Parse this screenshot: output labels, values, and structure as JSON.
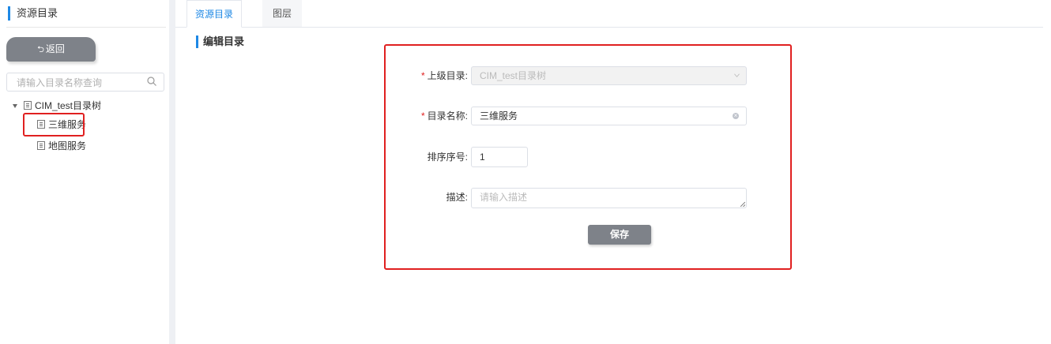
{
  "sidebar": {
    "title": "资源目录",
    "back_label": "返回",
    "back_icon": "return-icon",
    "search": {
      "placeholder": "请输入目录名称查询",
      "value": "",
      "icon": "search-icon"
    },
    "tree": [
      {
        "label": "CIM_test目录树",
        "expanded": true,
        "icon": "document-icon"
      },
      {
        "label": "三维服务",
        "icon": "document-icon",
        "selected": true
      },
      {
        "label": "地图服务",
        "icon": "document-icon"
      }
    ]
  },
  "tabs": [
    {
      "label": "资源目录",
      "active": true
    },
    {
      "label": "图层",
      "active": false
    }
  ],
  "page_title": "编辑目录",
  "form": {
    "parent": {
      "label": "上级目录:",
      "required": true,
      "value": "CIM_test目录树",
      "disabled": true
    },
    "name": {
      "label": "目录名称:",
      "required": true,
      "value": "三维服务"
    },
    "order": {
      "label": "排序序号:",
      "value": "1"
    },
    "desc": {
      "label": "描述:",
      "placeholder": "请输入描述",
      "value": ""
    },
    "save_label": "保存"
  },
  "colors": {
    "accent": "#1e88e5",
    "highlight": "#e02020",
    "button": "#7e8289"
  }
}
